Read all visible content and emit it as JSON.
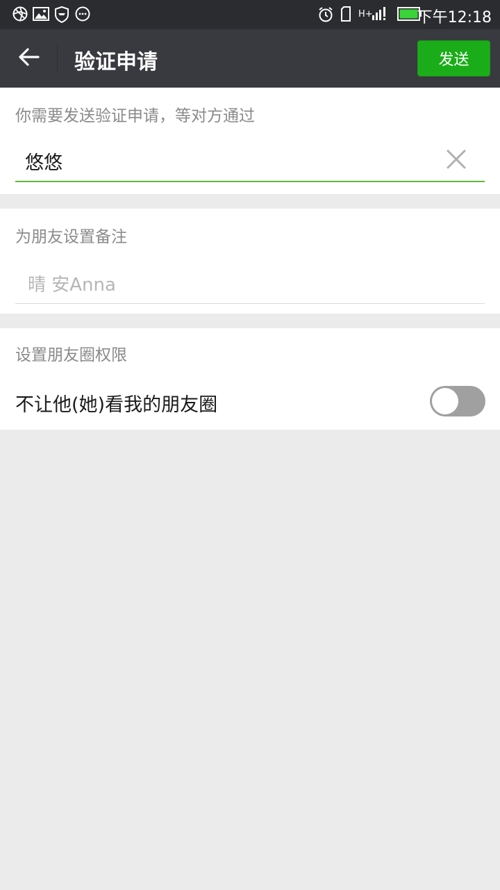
{
  "status_bar": {
    "time": "下午12:18",
    "network": "H+",
    "icons": [
      "aperture-icon",
      "image-icon",
      "shield-icon",
      "more-icon",
      "alarm-icon",
      "sim-icon",
      "signal-icon",
      "battery-icon"
    ]
  },
  "header": {
    "title": "验证申请",
    "send_label": "发送",
    "back_icon": "arrow-left-icon"
  },
  "verification": {
    "label": "你需要发送验证申请，等对方通过",
    "value": "悠悠",
    "clear_icon": "close-icon"
  },
  "remark": {
    "label": "为朋友设置备注",
    "placeholder": "晴 安Anna"
  },
  "moments": {
    "label": "设置朋友圈权限",
    "toggle_label": "不让他(她)看我的朋友圈",
    "toggle_on": false
  },
  "colors": {
    "status_bar": "#2b2c2f",
    "title_bar": "#393a3f",
    "accent_green": "#1aad19",
    "focus_line": "#5fb83a",
    "background": "#ebebeb"
  }
}
